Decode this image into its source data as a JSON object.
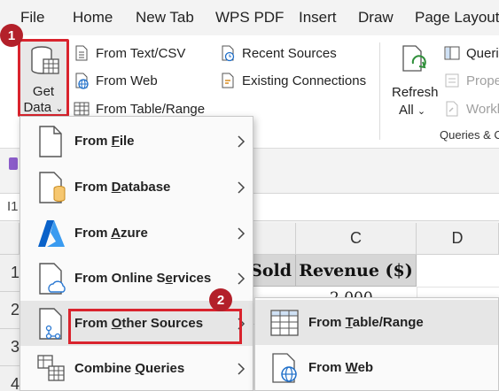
{
  "menubar": {
    "items": [
      "File",
      "Home",
      "New Tab",
      "WPS PDF",
      "Insert",
      "Draw",
      "Page Layout"
    ]
  },
  "ribbon": {
    "get_data": {
      "line1": "Get",
      "line2": "Data",
      "caret": "⌄"
    },
    "get_transform": [
      {
        "label": "From Text/CSV",
        "icon": "text-file-icon"
      },
      {
        "label": "From Web",
        "icon": "web-file-icon"
      },
      {
        "label": "From Table/Range",
        "icon": "table-icon"
      }
    ],
    "sources": [
      {
        "label": "Recent Sources",
        "icon": "clock-file-icon"
      },
      {
        "label": "Existing Connections",
        "icon": "connection-file-icon"
      }
    ],
    "refresh": {
      "line1": "Refresh",
      "line2": "All",
      "caret": "⌄"
    },
    "queries": [
      {
        "label": "Querie",
        "enabled": true
      },
      {
        "label": "Prope",
        "enabled": false
      },
      {
        "label": "Workl",
        "enabled": false
      }
    ],
    "queries_group_label": "Queries & C"
  },
  "badges": {
    "step1": "1",
    "step2": "2"
  },
  "formula_bar": {
    "name_box": "I1"
  },
  "sheet": {
    "columns": [
      "C",
      "D"
    ],
    "rows": [
      "1",
      "2",
      "3",
      "4"
    ],
    "header_cells": {
      "b": "Sold",
      "c": "Revenue ($)"
    },
    "partial_value": "2,000"
  },
  "dropdown": {
    "items": [
      {
        "pre": "From ",
        "key": "F",
        "post": "ile",
        "icon": "file-icon"
      },
      {
        "pre": "From ",
        "key": "D",
        "post": "atabase",
        "icon": "database-icon"
      },
      {
        "pre": "From ",
        "key": "A",
        "post": "zure",
        "icon": "azure-icon"
      },
      {
        "pre": "From Online S",
        "key": "e",
        "post": "rvices",
        "icon": "online-services-icon"
      },
      {
        "pre": "From ",
        "key": "O",
        "post": "ther Sources",
        "icon": "other-sources-icon"
      },
      {
        "pre": "Combine ",
        "key": "Q",
        "post": "ueries",
        "icon": "combine-queries-icon"
      }
    ]
  },
  "submenu": {
    "items": [
      {
        "pre": "From ",
        "key": "T",
        "post": "able/Range",
        "icon": "table-range-icon"
      },
      {
        "pre": "From ",
        "key": "W",
        "post": "eb",
        "icon": "web-icon"
      }
    ]
  },
  "colors": {
    "accent_red": "#d9232d",
    "badge": "#b3202a",
    "azure_blue": "#0a62c9",
    "db_orange": "#e8a33c",
    "green": "#2f8f3a"
  }
}
